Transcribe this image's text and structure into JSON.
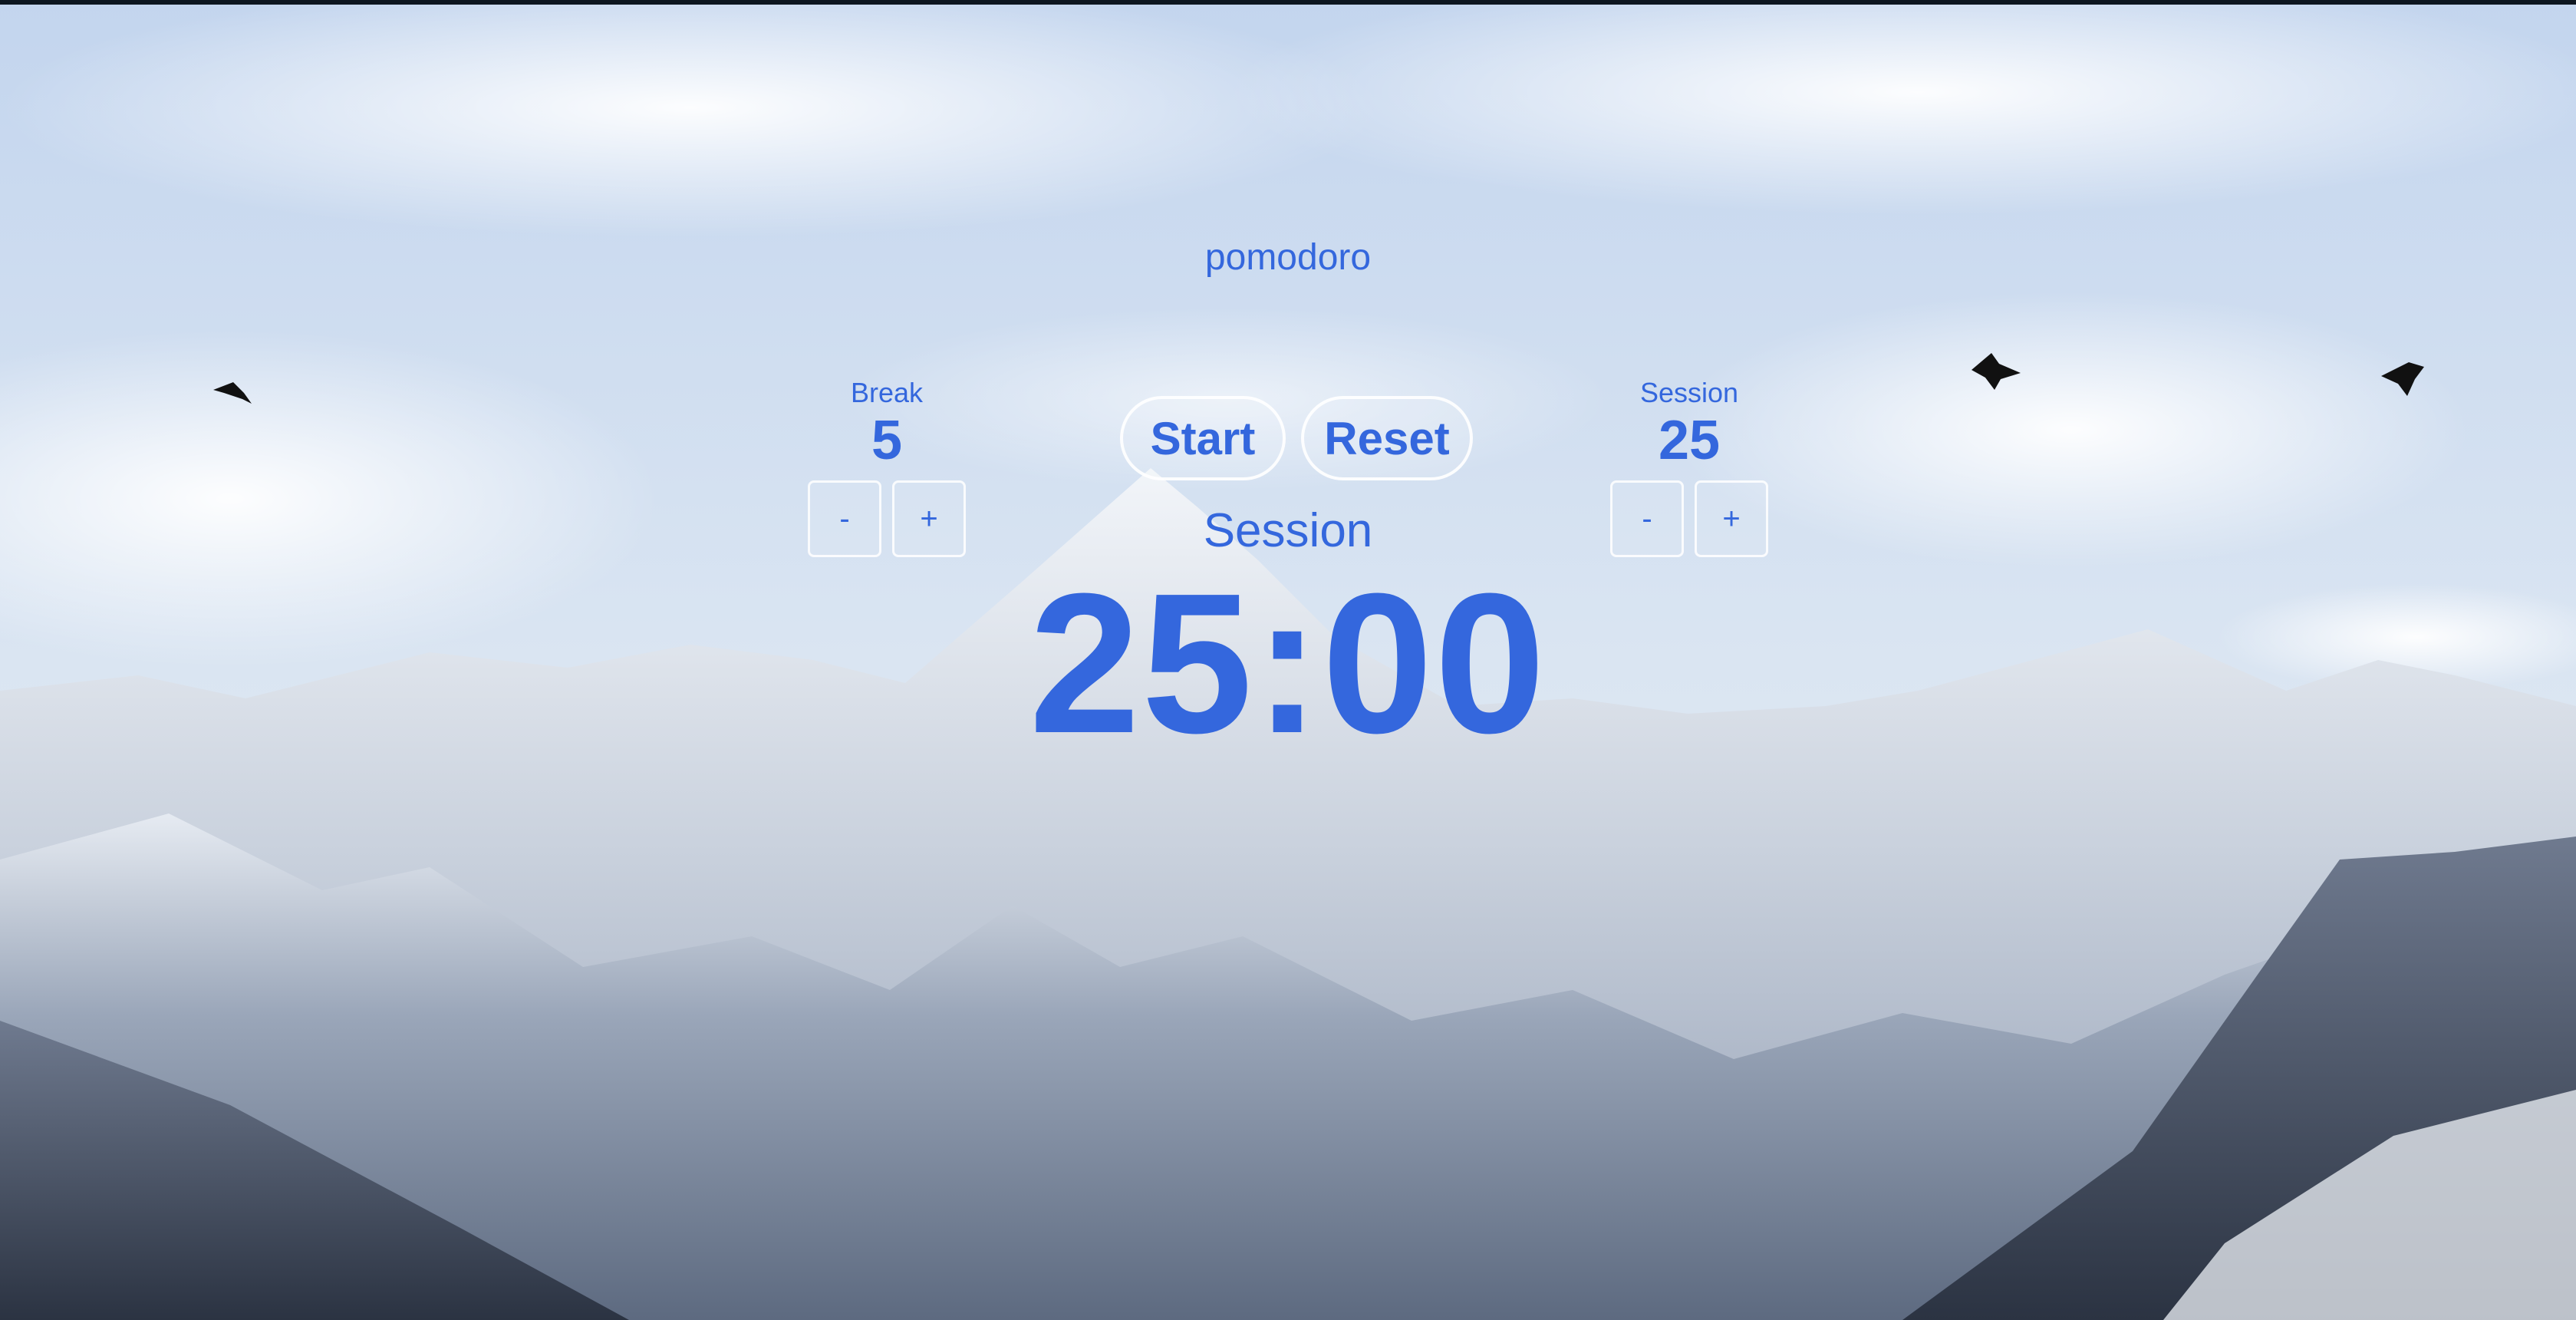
{
  "app": {
    "title": "pomodoro"
  },
  "break_setting": {
    "label": "Break",
    "value": "5",
    "decrement_label": "-",
    "increment_label": "+"
  },
  "session_setting": {
    "label": "Session",
    "value": "25",
    "decrement_label": "-",
    "increment_label": "+"
  },
  "controls": {
    "start_label": "Start",
    "reset_label": "Reset"
  },
  "timer": {
    "mode": "Session",
    "display": "25:00"
  },
  "colors": {
    "accent": "#3467dd",
    "button_border": "#ffffff"
  },
  "background": {
    "icon": "mountain-landscape-photo"
  }
}
